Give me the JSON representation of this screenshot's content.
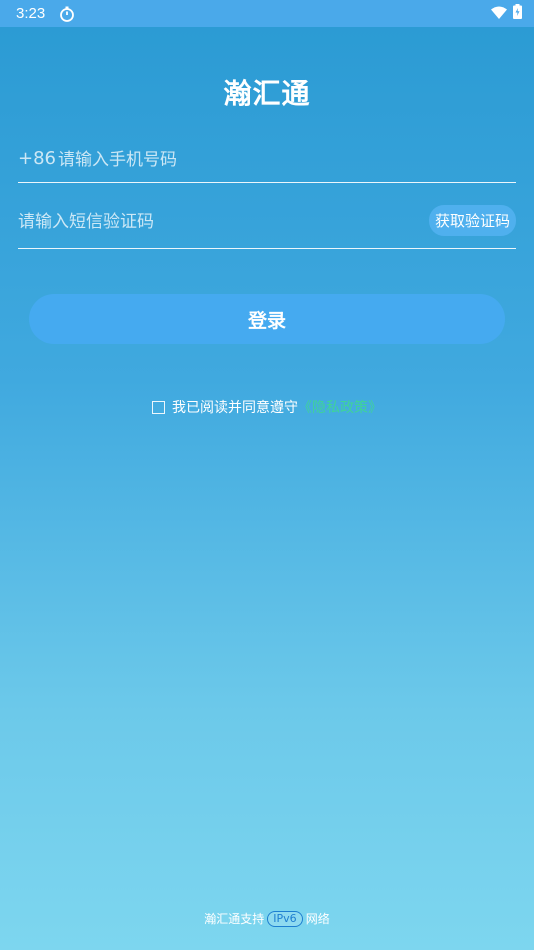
{
  "status_bar": {
    "time": "3:23",
    "icons": [
      "timer-icon",
      "wifi-icon",
      "battery-icon"
    ]
  },
  "app": {
    "title": "瀚汇通"
  },
  "phone_field": {
    "prefix": "+86",
    "placeholder": "请输入手机号码"
  },
  "code_field": {
    "placeholder": "请输入短信验证码",
    "get_code_label": "获取验证码"
  },
  "login_button": {
    "label": "登录"
  },
  "agreement": {
    "text": "我已阅读并同意遵守",
    "link_label": "《隐私政策》",
    "checked": false
  },
  "footer": {
    "prefix": "瀚汇通支持",
    "badge": "IPv6",
    "suffix": "网络"
  },
  "colors": {
    "background_top": "#2a9ad3",
    "background_bottom": "#7dd6ef",
    "status_bar": "#4aa9ea",
    "button": "#45aaf0",
    "link": "#3fd39a"
  }
}
